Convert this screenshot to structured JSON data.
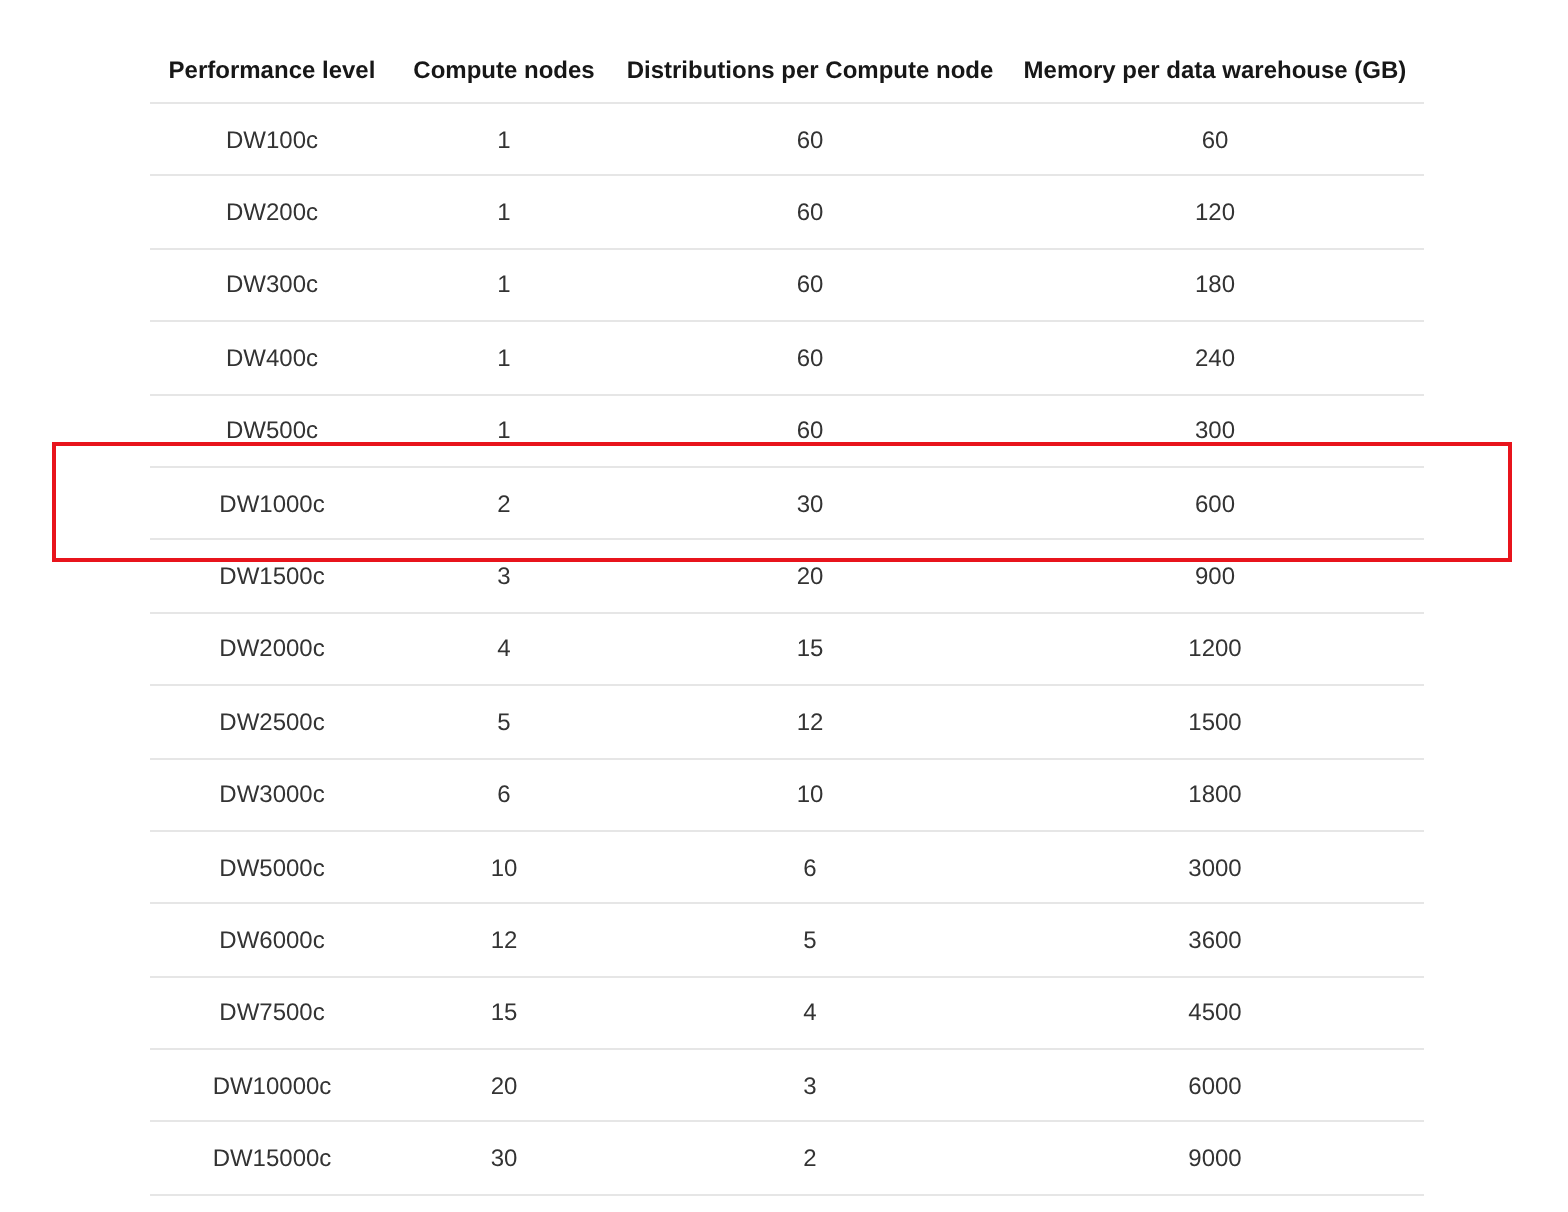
{
  "table": {
    "columns": [
      "Performance level",
      "Compute nodes",
      "Distributions per Compute node",
      "Memory per data warehouse (GB)"
    ],
    "rows": [
      {
        "cells": [
          "DW100c",
          "1",
          "60",
          "60"
        ],
        "highlighted": false
      },
      {
        "cells": [
          "DW200c",
          "1",
          "60",
          "120"
        ],
        "highlighted": false
      },
      {
        "cells": [
          "DW300c",
          "1",
          "60",
          "180"
        ],
        "highlighted": false
      },
      {
        "cells": [
          "DW400c",
          "1",
          "60",
          "240"
        ],
        "highlighted": false
      },
      {
        "cells": [
          "DW500c",
          "1",
          "60",
          "300"
        ],
        "highlighted": false
      },
      {
        "cells": [
          "DW1000c",
          "2",
          "30",
          "600"
        ],
        "highlighted": true
      },
      {
        "cells": [
          "DW1500c",
          "3",
          "20",
          "900"
        ],
        "highlighted": false
      },
      {
        "cells": [
          "DW2000c",
          "4",
          "15",
          "1200"
        ],
        "highlighted": false
      },
      {
        "cells": [
          "DW2500c",
          "5",
          "12",
          "1500"
        ],
        "highlighted": false
      },
      {
        "cells": [
          "DW3000c",
          "6",
          "10",
          "1800"
        ],
        "highlighted": false
      },
      {
        "cells": [
          "DW5000c",
          "10",
          "6",
          "3000"
        ],
        "highlighted": false
      },
      {
        "cells": [
          "DW6000c",
          "12",
          "5",
          "3600"
        ],
        "highlighted": false
      },
      {
        "cells": [
          "DW7500c",
          "15",
          "4",
          "4500"
        ],
        "highlighted": false
      },
      {
        "cells": [
          "DW10000c",
          "20",
          "3",
          "6000"
        ],
        "highlighted": false
      },
      {
        "cells": [
          "DW15000c",
          "30",
          "2",
          "9000"
        ],
        "highlighted": false
      }
    ]
  }
}
